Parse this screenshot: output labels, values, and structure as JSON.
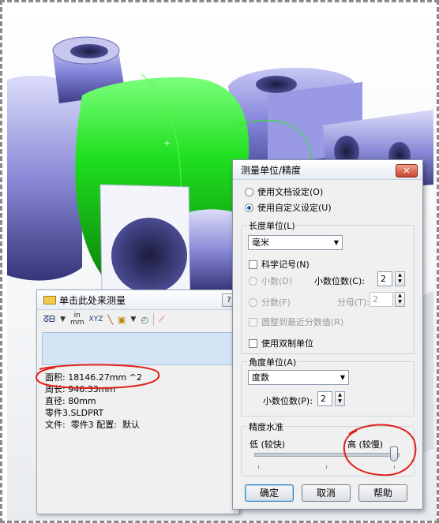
{
  "measure_panel": {
    "title": "单击此处来测量",
    "help": "?",
    "toolbar": {
      "arc_tool": "ᘔᗷ",
      "unit_tool": "in\nmm",
      "xyz_tool": "XYZ"
    },
    "results": [
      "面积: 18146.27mm ^2",
      "周长: 946.33mm",
      "直径: 80mm",
      "零件3.SLDPRT",
      "文件:  零件3 配置:  默认"
    ]
  },
  "units_dialog": {
    "title": "测量单位/精度",
    "close": "✕",
    "use_document": "使用文档设定(O)",
    "use_custom": "使用自定义设定(U)",
    "length_group": "长度单位(L)",
    "length_unit": "毫米",
    "scientific": "科学记号(N)",
    "decimal": "小数(D)",
    "decimal_places_label": "小数位数(C):",
    "decimal_places": "2",
    "fraction": "分数(F)",
    "denominator_label": "分母(T):",
    "denominator": "2",
    "round_nearest": "圆整到最近分数值(R)",
    "dual_units": "使用双制单位",
    "angle_group": "角度单位(A)",
    "angle_unit": "度数",
    "angle_places_label": "小数位数(P):",
    "angle_places": "2",
    "precision_group": "精度水准",
    "precision_low": "低 (较快)",
    "precision_high": "高 (较慢)",
    "precision_level": 1.0,
    "ok": "确定",
    "cancel": "取消",
    "help": "帮助"
  },
  "colors": {
    "part_body": "#8c8ce0",
    "selected_face": "#22e022",
    "annotation": "#e0201a"
  }
}
